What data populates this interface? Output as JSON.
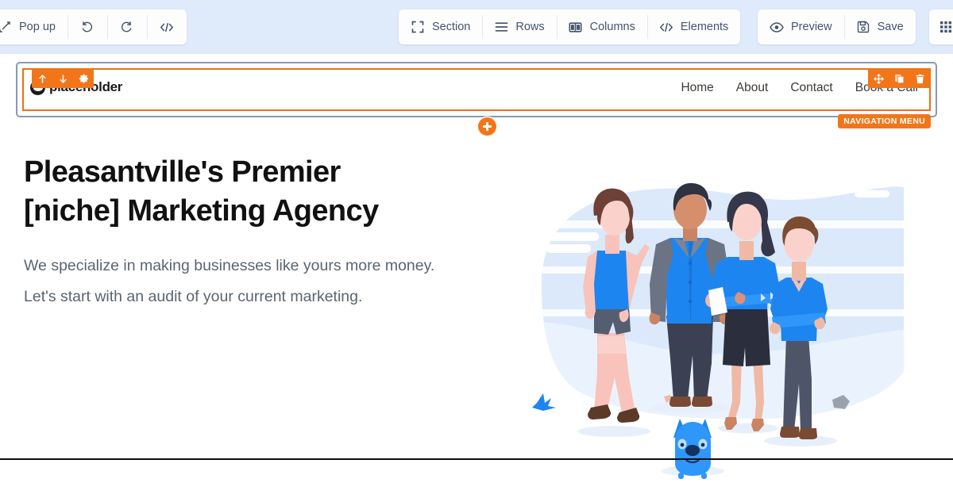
{
  "toolbar": {
    "left_group": [
      {
        "label": "Pop up",
        "icon": "popup-icon"
      },
      {
        "label": "",
        "icon": "undo-icon"
      },
      {
        "label": "",
        "icon": "redo-icon"
      },
      {
        "label": "",
        "icon": "code-icon"
      }
    ],
    "center_group": [
      {
        "label": "Section",
        "icon": "section-frame-icon"
      },
      {
        "label": "Rows",
        "icon": "rows-hamburger-icon"
      },
      {
        "label": "Columns",
        "icon": "columns-icon"
      },
      {
        "label": "Elements",
        "icon": "code-elements-icon"
      }
    ],
    "right_group": [
      {
        "label": "Preview",
        "icon": "eye-icon"
      },
      {
        "label": "Save",
        "icon": "floppy-disk-icon"
      }
    ],
    "apps_button": {
      "label": "",
      "icon": "grid-apps-icon"
    },
    "background_color": "#dfeafb"
  },
  "editor": {
    "selected_element_tag": "NAVIGATION MENU",
    "selected_outline_color": "#ed7014",
    "section_outline_color": "#8899b8",
    "accent_color": "#f2751a",
    "element_controls_left": [
      {
        "icon": "arrow-up-icon",
        "name": "move-up"
      },
      {
        "icon": "arrow-down-icon",
        "name": "move-down"
      },
      {
        "icon": "gear-icon",
        "name": "settings"
      }
    ],
    "element_controls_right": [
      {
        "icon": "move-cross-icon",
        "name": "drag-move"
      },
      {
        "icon": "duplicate-icon",
        "name": "duplicate"
      },
      {
        "icon": "trash-icon",
        "name": "delete"
      }
    ],
    "add_button": {
      "icon": "plus-icon",
      "name": "add-section"
    }
  },
  "site": {
    "logo_text": "placeholder",
    "nav_items": [
      {
        "label": "Home"
      },
      {
        "label": "About"
      },
      {
        "label": "Contact"
      },
      {
        "label": "Book a Call"
      }
    ],
    "hero": {
      "heading_line1": "Pleasantville's Premier",
      "heading_line2": "[niche] Marketing Agency",
      "paragraph": "We specialize in making businesses like yours more money. Let's start with an audit of your current marketing.",
      "illustration": "team-group-with-dog-illustration"
    }
  }
}
